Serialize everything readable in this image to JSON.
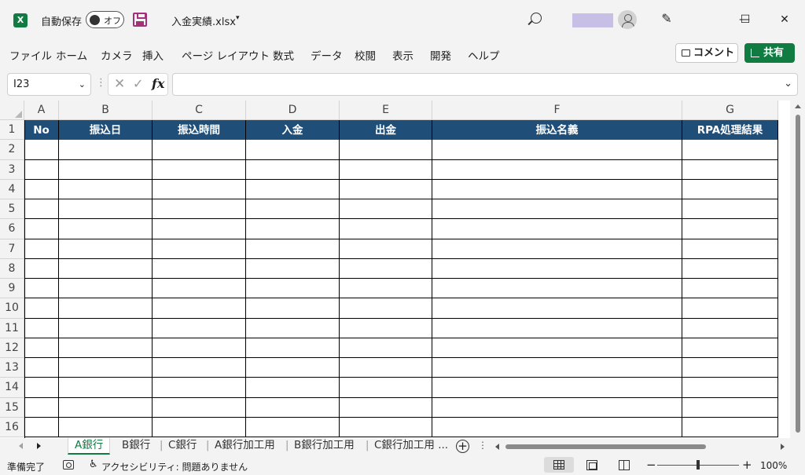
{
  "titlebar": {
    "app_icon": "excel-logo-icon",
    "app_letter": "X",
    "autosave_label": "自動保存",
    "autosave_state": "オフ",
    "file_name": "入金実績.xlsx",
    "file_caret": "▾",
    "search_icon": "search-icon",
    "pen_glyph": "✎",
    "minimize": "—",
    "maximize": "☐",
    "close": "✕"
  },
  "menu": {
    "items": [
      "ファイル",
      "ホーム",
      "カメラ",
      "挿入",
      "ページ レイアウト",
      "数式",
      "データ",
      "校閲",
      "表示",
      "開発",
      "ヘルプ"
    ],
    "comment_label": "コメント",
    "share_label": "共有"
  },
  "formula_bar": {
    "name_box": "I23",
    "dropdown": "⌄",
    "separator": "⋮",
    "cancel_glyph": "✕",
    "enter_glyph": "✓",
    "fx_label": "fx",
    "formula_value": ""
  },
  "sheet": {
    "column_letters": [
      "A",
      "B",
      "C",
      "D",
      "E",
      "F",
      "G"
    ],
    "row_numbers": [
      "1",
      "2",
      "3",
      "4",
      "5",
      "6",
      "7",
      "8",
      "9",
      "10",
      "11",
      "12",
      "13",
      "14",
      "15",
      "16"
    ],
    "table_headers": [
      "No",
      "振込日",
      "振込時間",
      "入金",
      "出金",
      "振込名義",
      "RPA処理結果"
    ],
    "header_fill": "#1f4e79",
    "header_text_color": "#ffffff"
  },
  "tabs": {
    "sheets": [
      "A銀行",
      "B銀行",
      "C銀行",
      "A銀行加工用",
      "B銀行加工用",
      "C銀行加工用 ..."
    ],
    "active": "A銀行",
    "add_glyph": "+",
    "more_glyph": "⋮",
    "accent": "#107c41"
  },
  "statusbar": {
    "ready": "準備完了",
    "accessibility": "アクセシビリティ: 問題ありません",
    "a11y_glyph": "♿",
    "zoom_minus": "−",
    "zoom_plus": "+",
    "zoom_level": "100%"
  }
}
